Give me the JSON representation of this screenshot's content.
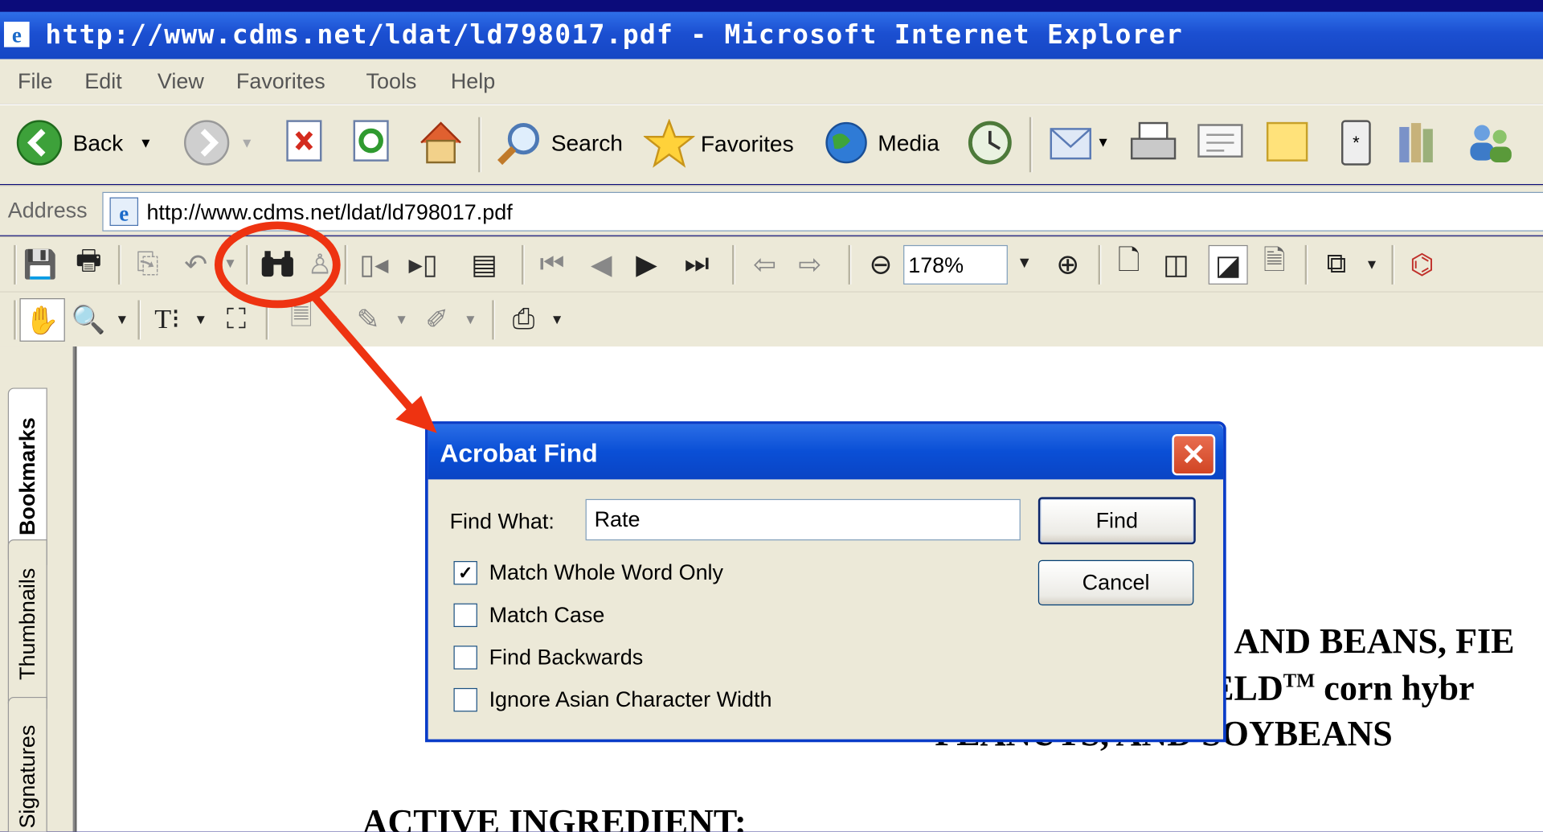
{
  "window": {
    "title": "http://www.cdms.net/ldat/ld798017.pdf - Microsoft Internet Explorer"
  },
  "menu": [
    "File",
    "Edit",
    "View",
    "Favorites",
    "Tools",
    "Help"
  ],
  "toolbar": {
    "back_label": "Back",
    "search_label": "Search",
    "favorites_label": "Favorites",
    "media_label": "Media"
  },
  "address": {
    "label": "Address",
    "url": "http://www.cdms.net/ldat/ld798017.pdf"
  },
  "acrobat": {
    "zoom": "178%"
  },
  "side_tabs": [
    "Bookmarks",
    "Thumbnails",
    "Signatures"
  ],
  "document": {
    "line1": "AND BEANS, FIE",
    "line2_prefix": "IELD",
    "line2_tm": "TM",
    "line2_suffix": " corn hybr",
    "line3": "PEANUTS, AND SOYBEANS",
    "line4": "ACTIVE INGREDIENT:"
  },
  "dialog": {
    "title": "Acrobat Find",
    "find_what_label": "Find What:",
    "find_value": "Rate",
    "find_button": "Find",
    "cancel_button": "Cancel",
    "options": [
      {
        "label": "Match Whole Word Only",
        "checked": true
      },
      {
        "label": "Match Case",
        "checked": false
      },
      {
        "label": "Find Backwards",
        "checked": false
      },
      {
        "label": "Ignore Asian Character Width",
        "checked": false
      }
    ]
  },
  "colors": {
    "annotation": "#ee3311",
    "titlebar": "#1b4fd1",
    "chrome": "#ece9d8"
  }
}
